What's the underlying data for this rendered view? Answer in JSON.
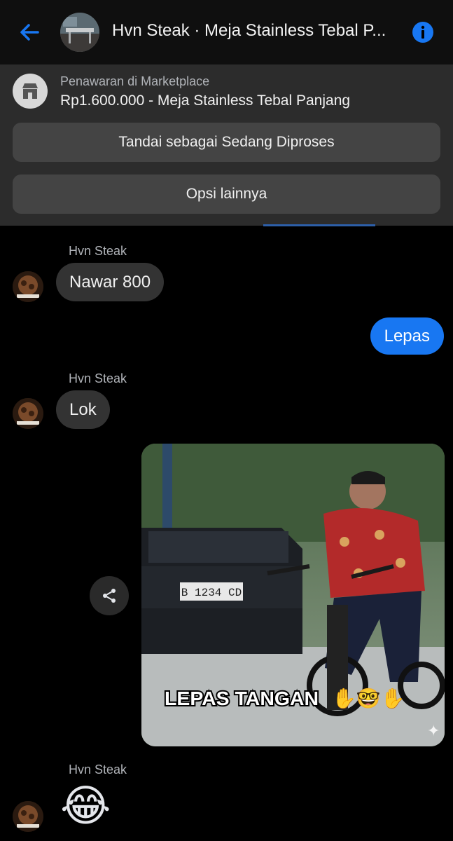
{
  "header": {
    "title": "Hvn Steak · Meja Stainless Tebal P...",
    "accent_color": "#1877f2",
    "back_icon": "arrow-left-icon",
    "info_icon": "info-icon"
  },
  "marketplace": {
    "subtitle": "Penawaran di Marketplace",
    "listing": "Rp1.600.000 - Meja Stainless Tebal Panjang",
    "mark_button": "Tandai sebagai Sedang Diproses",
    "options_button": "Opsi lainnya",
    "icon": "store-icon"
  },
  "messages": [
    {
      "sender": "Hvn Steak",
      "text": "Nawar 800",
      "direction": "incoming"
    },
    {
      "text": "Lepas",
      "direction": "outgoing"
    },
    {
      "sender": "Hvn Steak",
      "text": "Lok",
      "direction": "incoming"
    },
    {
      "direction": "outgoing",
      "type": "image",
      "caption": "LEPAS TANGAN ✋🤓✋",
      "plate": "B 1234 CD"
    },
    {
      "sender": "Hvn Steak",
      "type": "emoji",
      "text": "😂"
    }
  ],
  "share_icon": "share-icon"
}
